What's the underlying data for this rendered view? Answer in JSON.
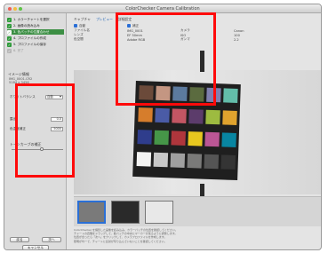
{
  "window": {
    "title": "ColorChecker Camera Calibration"
  },
  "sidebar": {
    "steps": [
      {
        "label": "1. カラーチャートを選択",
        "state": "done"
      },
      {
        "label": "2. 画像の読み込み",
        "state": "done"
      },
      {
        "label": "3. 色パッチの位置合わせ",
        "state": "active"
      },
      {
        "label": "4. プロファイルの作成",
        "state": "done"
      },
      {
        "label": "5. プロファイルの保存",
        "state": "done"
      },
      {
        "label": "6. 完了",
        "state": "dim"
      }
    ],
    "image_info_title": "イメージ情報",
    "image_info_lines": [
      "IMG_0001.CR2",
      "5184 x 3456"
    ],
    "fields": [
      {
        "label": "ホワイトバランス",
        "value": "自動"
      },
      {
        "label": "露出",
        "value": "0.0"
      },
      {
        "label": "色温度補正",
        "value": "5000"
      }
    ],
    "slider_label": "トーンカーブの補正",
    "slider_value": 0.6
  },
  "main": {
    "tabs": [
      "キャプチャ",
      "プレビュー",
      "詳細設定"
    ],
    "checks": [
      "自動",
      "補正"
    ],
    "info_rows": [
      [
        "ファイル名",
        "IMG_0001",
        "カメラ",
        "Canon"
      ],
      [
        "レンズ",
        "EF 50mm",
        "ISO",
        "100"
      ],
      [
        "色空間",
        "Adobe RGB",
        "ガンマ",
        "2.2"
      ]
    ],
    "description": [
      "ColorChecker を撮影した画像を読み込み、カラーパッチの位置を確認してください。",
      "チャートの四隅をドラッグして、各パッチの中央にマーカーが来るように調整します。",
      "位置が合ったら「次へ」をクリックして、カメラプロファイルを作成します。",
      "照明が均一で、チャートに反射が写り込んでいないことを確認してください。"
    ]
  },
  "buttons": {
    "back": "戻る",
    "next": "次へ",
    "cancel": "キャンセル"
  },
  "patch_colors": [
    "#6b4a3a",
    "#c49682",
    "#5c7a9e",
    "#5b6b3f",
    "#8080b0",
    "#63bdaa",
    "#d67d2c",
    "#4a5ba6",
    "#c35663",
    "#5c3c6b",
    "#9dbb40",
    "#e0a32e",
    "#2f3d8c",
    "#469648",
    "#af363c",
    "#e7c71f",
    "#bb5695",
    "#0885a1",
    "#f3f3f2",
    "#c8c8c8",
    "#a0a0a0",
    "#7a7a79",
    "#555555",
    "#343434"
  ],
  "thumbnails": [
    {
      "name": "thumb-original",
      "bg": "#7a7a7a"
    },
    {
      "name": "thumb-dark",
      "bg": "#2a2a2a"
    },
    {
      "name": "thumb-light",
      "bg": "#e8e8e8"
    }
  ],
  "highlight_color": "#ff0a0a"
}
